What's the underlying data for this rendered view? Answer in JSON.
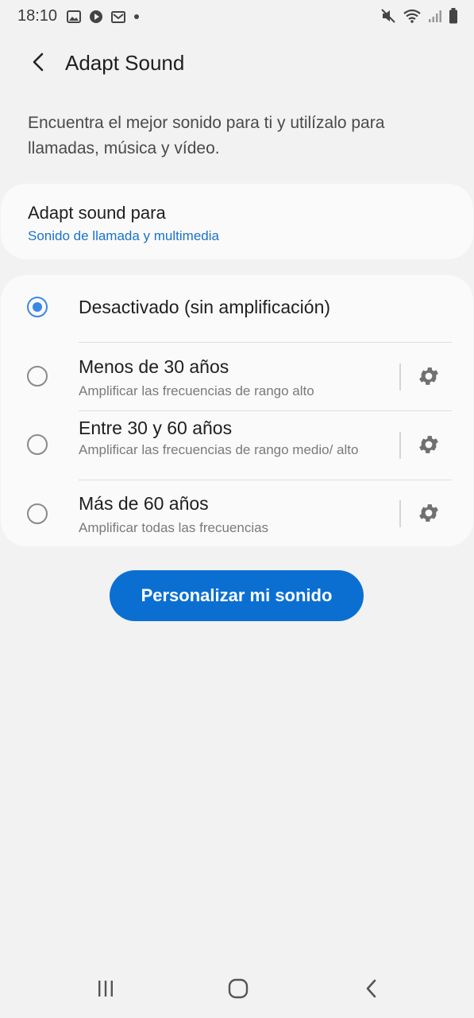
{
  "status_bar": {
    "time": "18:10",
    "left_icons": [
      "image-icon",
      "play-circle-icon",
      "mail-icon",
      "dot-icon"
    ],
    "right_icons": [
      "mute-icon",
      "wifi-icon",
      "signal-icon",
      "battery-icon"
    ]
  },
  "header": {
    "title": "Adapt Sound"
  },
  "description": "Encuentra el mejor sonido para ti y utilízalo para llamadas, música y vídeo.",
  "adapt_sound_for": {
    "label": "Adapt sound para",
    "value": "Sonido de llamada y multimedia"
  },
  "options": [
    {
      "title": "Desactivado (sin amplificación)",
      "subtitle": "",
      "selected": true
    },
    {
      "title": "Menos de 30 años",
      "subtitle": "Amplificar las frecuencias de rango alto",
      "selected": false
    },
    {
      "title": "Entre 30 y 60 años",
      "subtitle": "Amplificar las frecuencias de rango medio/ alto",
      "selected": false
    },
    {
      "title": "Más de 60 años",
      "subtitle": "Amplificar todas las frecuencias",
      "selected": false
    }
  ],
  "personalize_button": "Personalizar mi sonido",
  "colors": {
    "accent": "#3b87e6",
    "button": "#0b6fd2",
    "link": "#1a73c9",
    "background": "#f2f2f2"
  }
}
